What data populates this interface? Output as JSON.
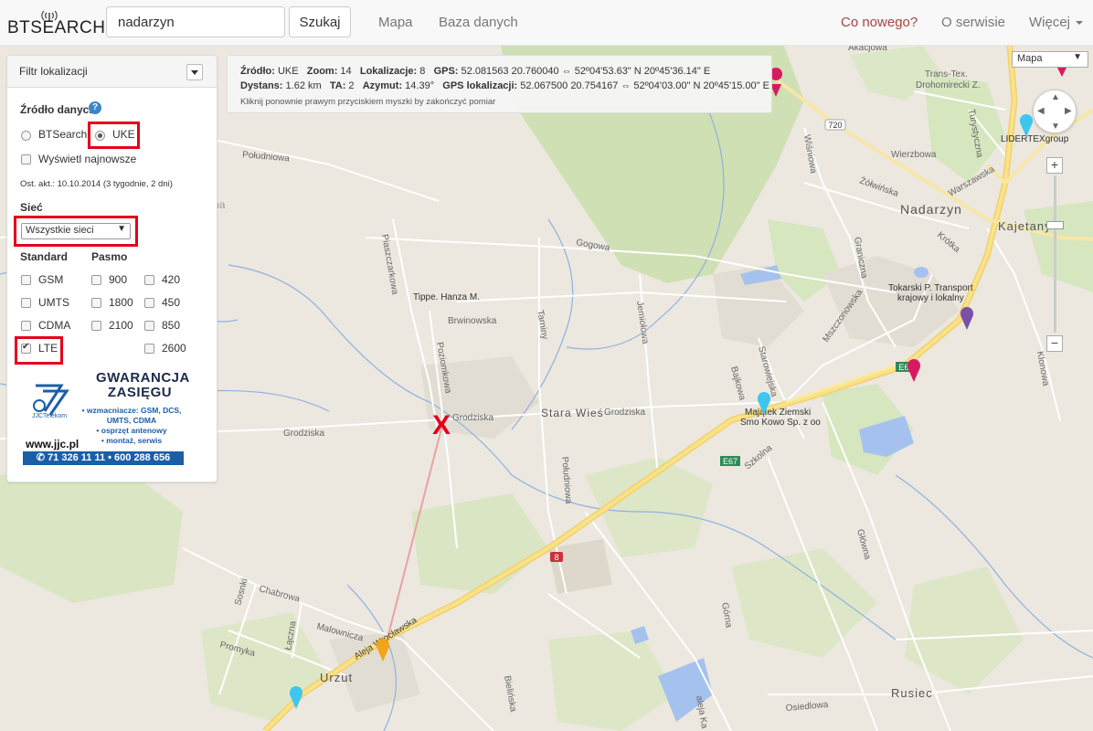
{
  "nav": {
    "logo": "BTSEARCH",
    "search_value": "nadarzyn",
    "search_button": "Szukaj",
    "links": [
      "Mapa",
      "Baza danych"
    ],
    "right": {
      "news": "Co nowego?",
      "about": "O serwisie",
      "more": "Więcej"
    }
  },
  "info": {
    "row1": {
      "source_label": "Źródło:",
      "source": "UKE",
      "zoom_label": "Zoom:",
      "zoom": "14",
      "loc_label": "Lokalizacje:",
      "loc": "8",
      "gps_label": "GPS:",
      "gps": "52.081563 20.760040 ⇔ 52º04'53.63\" N 20º45'36.14\" E"
    },
    "row2": {
      "dist_label": "Dystans:",
      "dist": "1.62 km",
      "ta_label": "TA:",
      "ta": "2",
      "az_label": "Azymut:",
      "az": "14.39°",
      "gpsloc_label": "GPS lokalizacji:",
      "gpsloc": "52.067500 20.754167 ⇔ 52º04'03.00\" N 20º45'15.00\" E"
    },
    "hint": "Kliknij ponownie prawym przyciskiem myszki by zakończyć pomiar"
  },
  "panel": {
    "title": "Filtr lokalizacji",
    "source_title": "Źródło danych",
    "help": "?",
    "opt_btsearch": "BTSearch",
    "opt_uke": "UKE",
    "show_newest": "Wyświetl najnowsze",
    "updated": "Ost. akt.: 10.10.2014 (3 tygodnie, 2 dni)",
    "network_title": "Sieć",
    "network_value": "Wszystkie sieci",
    "standard_title": "Standard",
    "band_title": "Pasmo",
    "standards": [
      "GSM",
      "UMTS",
      "CDMA",
      "LTE"
    ],
    "bands_col1": [
      "900",
      "1800",
      "2100"
    ],
    "bands_col2": [
      "420",
      "450",
      "850",
      "2600"
    ]
  },
  "ad": {
    "title1": "GWARANCJA",
    "title2": "ZASIĘGU",
    "b1": "• wzmacniacze: GSM, DCS,",
    "b2": "UMTS, CDMA",
    "b3": "• osprzęt antenowy",
    "b4": "• montaż, serwis",
    "www": "www.jjc.pl",
    "phone": "✆ 71 326 11 11 • 600 288 656",
    "logo_text": "JJCTelekom"
  },
  "map": {
    "type": "Mapa",
    "zoom_in": "+",
    "zoom_out": "−",
    "marker": "X",
    "labels": {
      "akacjowa": "Akacjowa",
      "trans1": "Trans-Tex.",
      "trans2": "Drohomirecki Z.",
      "lidertex": "LIDERTEXgroup",
      "turystyczna": "Turystyczna",
      "wisniowa": "Wiśniowa",
      "wierzbowa": "Wierzbowa",
      "zolwinska": "Żółwińska",
      "warszawska": "Warszawska",
      "nadarzyn": "Nadarzyn",
      "kajetany": "Kajetany",
      "krotka": "Krótka",
      "graniczna": "Graniczna",
      "mszczonowska": "Mszczonowska",
      "tokarski1": "Tokarski P. Transport",
      "tokarski2": "krajowy i lokalny",
      "klonowa": "Klonowa",
      "e6": "E6",
      "e67": "E67",
      "road720": "720",
      "road8": "8",
      "starowiejska": "Starowiejska",
      "bajkowa": "Bajkowa",
      "majatek1": "Majątek Ziemski",
      "majatek2": "Smo Kowo Sp. z oo",
      "szkolna": "Szkolna",
      "glowna": "Główna",
      "poludnie": "Południowa",
      "stara_wies": "Stara Wieś",
      "grodziska1": "Grodziska",
      "grodziska2": "Grodziska",
      "grodziska3": "Grodziska",
      "brwinowska": "Brwinowska",
      "tippe": "Tippe. Hanza M.",
      "piaskowa": "Piaskowa",
      "piaszczarkowa": "Piaszczarkowa",
      "poziomkowa": "Poziomkowa",
      "tarniny": "Tarniny",
      "jemiolowa": "Jemiołowa",
      "gogowa": "Gogowa",
      "poludniowa": "Południowa",
      "kopana": "Kopana",
      "sekwana": "Sekwana",
      "chabrowa": "Chabrowa",
      "malownicza": "Malownicza",
      "promyka": "Promyka",
      "sosnki": "Sosnki",
      "laczna": "Łączna",
      "aleja_w": "Aleja Wrocławska",
      "urzut": "Urzut",
      "bielinska": "Bielińska",
      "gorna": "Górna",
      "aleja_k": "aleja Ka",
      "osiedlowa": "Osiedlowa",
      "rusiec": "Rusiec"
    }
  }
}
